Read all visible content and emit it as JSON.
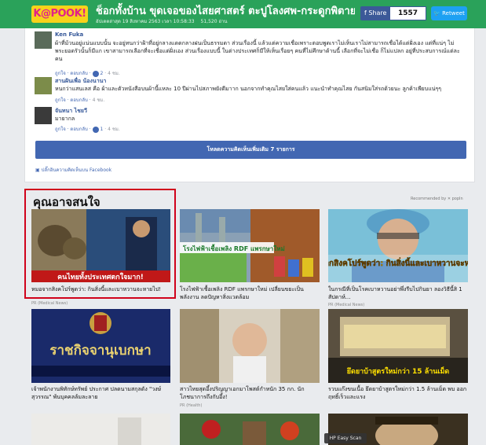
{
  "header": {
    "logo": "K@POOK!",
    "headline": "ช็อกทั้งบ้าน ขุดเจอของไสยศาสตร์ ตะปูโลงศพ-กระดูกพิตายโหง",
    "meta": [
      "อัปเดตล่าสุด 19 สิงหาคม 2563 เวลา 10:58:33",
      "51,520 อ่าน"
    ],
    "share_label": "Share",
    "share_count": "1557",
    "retweet_label": "Retweet"
  },
  "comments": [
    {
      "name": "Ken Fuka",
      "text": "ผ้าที่ม้วนอยู่แน่นแบบนั้น จะอยู่ทนกว่าฝ้าที่อยู่กลางแดดกลางฝนเป็นธรรมดา ส่วนเรื่องนี้ แล้วแต่ความเชื่อเพราะตอบพูดเราไม่เห็นเราไม่สามารถเชื่อได้แต่ฝั่งเอง แต่ที่แน่ๆ ไม่พระยอดรัวนั้นก็มีแก เขาสามารถเลือกที่จะเชื่อแต่ฝั่งเอง ส่วนเรื่องแบบนี้ ในต่างประเทศก็มีให้เห็นเรื่อยๆ คนที่ไม่ศึกษาด้านนี้ เลือกที่จะไม่เชื่อ ก็ไม่แปลก อยู่ที่ประสบการณ์แต่ละคน",
      "actions": "ถูกใจ · ตอบกลับ ·",
      "likes": "2",
      "time": "· 4 ชม."
    },
    {
      "name": "สานฝันเพื่อ น้องนานา",
      "text": "หนกว่าแสนเลส คือ ผ้าและตัวหนังสือบนผ้านี้แหละ 10 ปีผ่านไปสภาพยังดีมาาก นอกจากทำคุณไสยใส่คนแล้ว แนะนำทำคุณไสย กันสนิมใส่รถด้วยนะ ลูกค้าเพียบแน่ๆๆ",
      "actions": "ถูกใจ · ตอบกลับ ·",
      "time": "4 ชม."
    },
    {
      "name": "จันทนา ไชยวี",
      "text": "มายากล",
      "actions": "ถูกใจ · ตอบกลับ ·",
      "likes": "1",
      "time": "· 4 ชม."
    }
  ],
  "load_more_label": "โหลดความคิดเห็นเพิ่มเติม 7 รายการ",
  "fb_plugin_label": "ปลั๊กอินความคิดเห็นบน Facebook",
  "recommend": {
    "heading": "คุณอาจสนใจ",
    "by_label": "Recommended by ✕ popIn",
    "cards": [
      {
        "title": "หมอจากสิงคโปร์พูดว่า: กินสิ่งนี้และเบาหวานจะหายไป!",
        "source": "PR (Medical News)",
        "thumb_caption": "คนไทยทั้งประเทศตกใจมาก!"
      },
      {
        "title": "โรงไฟฟ้าเชื้อเพลิง RDF แพรกษาใหม่ เปลี่ยนขยะเป็นพลังงาน ลดปัญหาสิ่งแวดล้อม",
        "source": "",
        "thumb_caption": "โรงไฟฟ้าเชื้อเพลิง RDF แพรกษาใหม่"
      },
      {
        "title": "ในกรณีที่เป็นโรคเบาหวานอย่าพึ่งรีบไปกินยา ลองวิธีนี้สิ 1 สัปดาห์...",
        "source": "PR (Medical News)",
        "thumb_caption": "หมอจากสิงคโปร์พูดว่า: กินสิ่งนี้และเบาหวานจะหายไป!"
      },
      {
        "title": "เจ้าพนักงานพิทักษ์ทรัพย์ ประกาศ ปลดนามสกุลดัง \"วงษ์สุวรรณ\" พ้นบุคคลล้มละลาย",
        "source": "",
        "thumb_caption": "ราชกิจจานุเบกษา"
      },
      {
        "title": "สาวไทยสุดอึ้งปริญญาเอกมาโพสต์กำหนัก 35 กก. นักโภชนาการถึงกับอึ้ง!",
        "source": "PR (Health)",
        "thumb_caption": ""
      },
      {
        "title": "รวบแก๊งขนเนื้อ ยึดยาบ้าสูตรใหม่กว่า 1.5 ล้านเม็ด พบ ออกฤทธิ์เร็วและแรง",
        "source": "",
        "thumb_caption": "ยึดยาบ้าสูตรใหม่กว่า 15 ล้านเม็ด"
      }
    ]
  },
  "hp_scan_label": "HP Easy Scan"
}
